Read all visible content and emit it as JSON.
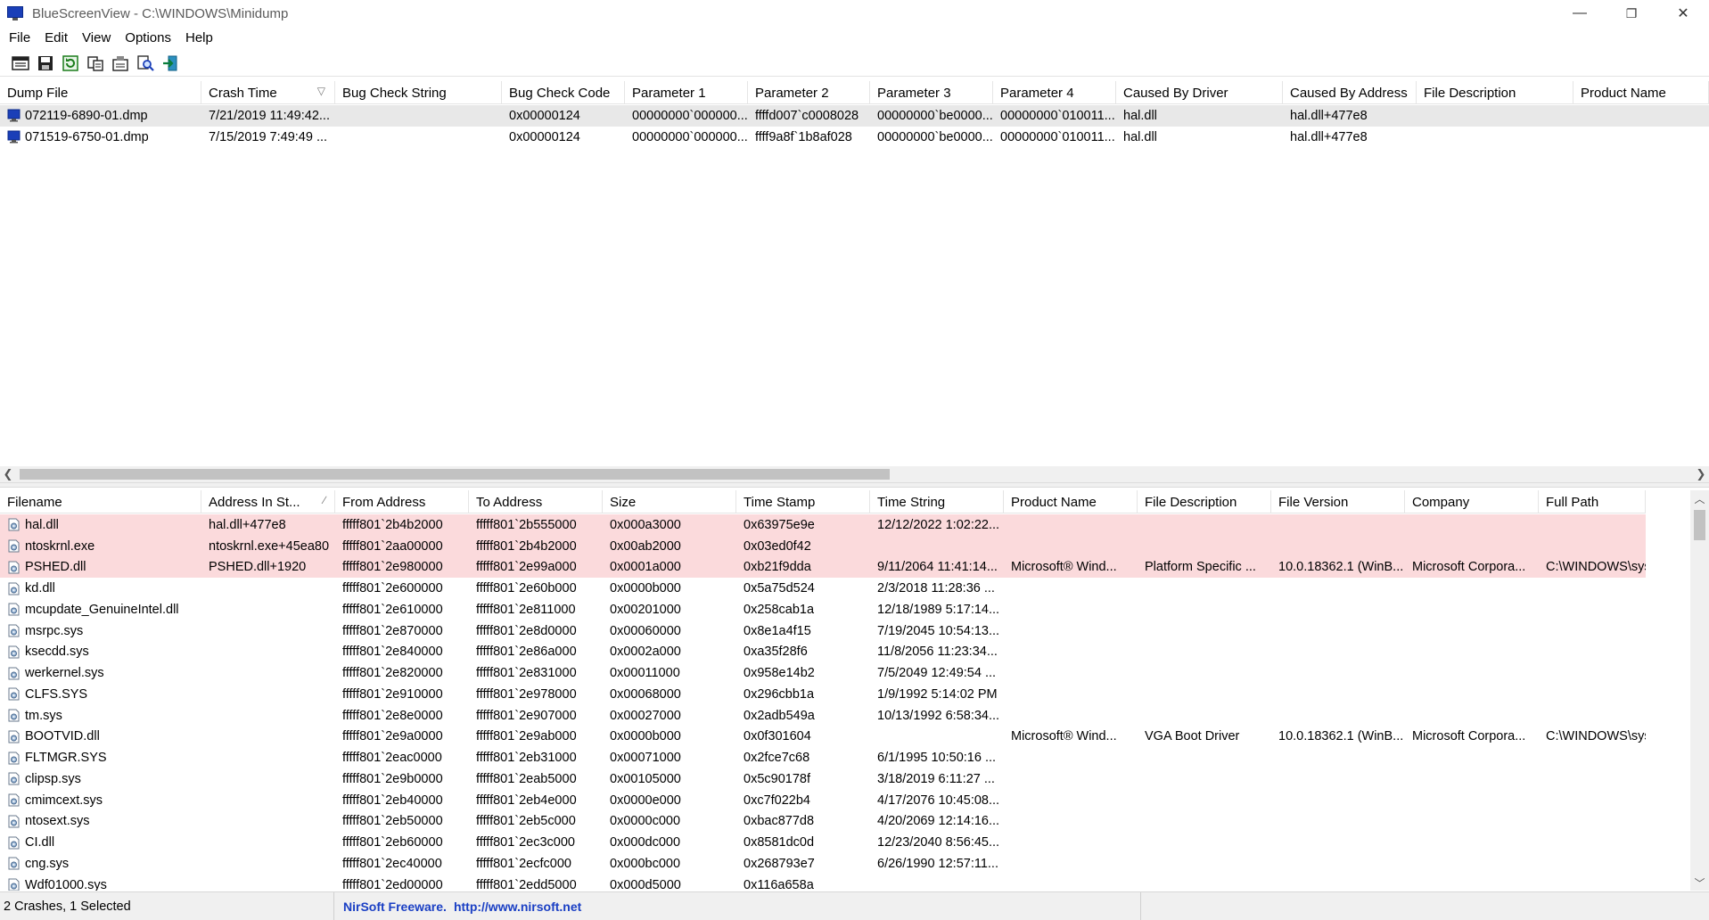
{
  "window": {
    "title": "BlueScreenView  -  C:\\WINDOWS\\Minidump",
    "minimize": "—",
    "restore": "❐",
    "close": "✕"
  },
  "menu": [
    "File",
    "Edit",
    "View",
    "Options",
    "Help"
  ],
  "toolbar": [
    {
      "name": "advanced-options-icon"
    },
    {
      "name": "save-icon"
    },
    {
      "name": "refresh-icon"
    },
    {
      "name": "copy-icon"
    },
    {
      "name": "properties-icon"
    },
    {
      "name": "find-icon"
    },
    {
      "name": "exit-icon"
    }
  ],
  "crash_list": {
    "columns": [
      {
        "label": "Dump File",
        "w": 226,
        "sort": ""
      },
      {
        "label": "Crash Time",
        "w": 150,
        "sort": "▽"
      },
      {
        "label": "Bug Check String",
        "w": 187,
        "sort": ""
      },
      {
        "label": "Bug Check Code",
        "w": 138,
        "sort": ""
      },
      {
        "label": "Parameter 1",
        "w": 138,
        "sort": ""
      },
      {
        "label": "Parameter 2",
        "w": 137,
        "sort": ""
      },
      {
        "label": "Parameter 3",
        "w": 138,
        "sort": ""
      },
      {
        "label": "Parameter 4",
        "w": 138,
        "sort": ""
      },
      {
        "label": "Caused By Driver",
        "w": 187,
        "sort": ""
      },
      {
        "label": "Caused By Address",
        "w": 150,
        "sort": ""
      },
      {
        "label": "File Description",
        "w": 176,
        "sort": ""
      },
      {
        "label": "Product Name",
        "w": 152,
        "sort": ""
      }
    ],
    "rows": [
      {
        "selected": true,
        "cells": [
          "072119-6890-01.dmp",
          "7/21/2019 11:49:42...",
          "",
          "0x00000124",
          "00000000`000000...",
          "ffffd007`c0008028",
          "00000000`be0000...",
          "00000000`010011...",
          "hal.dll",
          "hal.dll+477e8",
          "",
          ""
        ]
      },
      {
        "selected": false,
        "cells": [
          "071519-6750-01.dmp",
          "7/15/2019 7:49:49 ...",
          "",
          "0x00000124",
          "00000000`000000...",
          "ffff9a8f`1b8af028",
          "00000000`be0000...",
          "00000000`010011...",
          "hal.dll",
          "hal.dll+477e8",
          "",
          ""
        ]
      }
    ]
  },
  "driver_list": {
    "columns": [
      {
        "label": "Filename",
        "w": 226,
        "sort": ""
      },
      {
        "label": "Address In St...",
        "w": 150,
        "sort": "∕"
      },
      {
        "label": "From Address",
        "w": 150,
        "sort": ""
      },
      {
        "label": "To Address",
        "w": 150,
        "sort": ""
      },
      {
        "label": "Size",
        "w": 150,
        "sort": ""
      },
      {
        "label": "Time Stamp",
        "w": 150,
        "sort": ""
      },
      {
        "label": "Time String",
        "w": 150,
        "sort": ""
      },
      {
        "label": "Product Name",
        "w": 150,
        "sort": ""
      },
      {
        "label": "File Description",
        "w": 150,
        "sort": ""
      },
      {
        "label": "File Version",
        "w": 150,
        "sort": ""
      },
      {
        "label": "Company",
        "w": 150,
        "sort": ""
      },
      {
        "label": "Full Path",
        "w": 120,
        "sort": ""
      }
    ],
    "rows": [
      {
        "highlight": true,
        "cells": [
          "hal.dll",
          "hal.dll+477e8",
          "fffff801`2b4b2000",
          "fffff801`2b555000",
          "0x000a3000",
          "0x63975e9e",
          "12/12/2022 1:02:22...",
          "",
          "",
          "",
          "",
          ""
        ]
      },
      {
        "highlight": true,
        "cells": [
          "ntoskrnl.exe",
          "ntoskrnl.exe+45ea80",
          "fffff801`2aa00000",
          "fffff801`2b4b2000",
          "0x00ab2000",
          "0x03ed0f42",
          "",
          "",
          "",
          "",
          "",
          ""
        ]
      },
      {
        "highlight": true,
        "cells": [
          "PSHED.dll",
          "PSHED.dll+1920",
          "fffff801`2e980000",
          "fffff801`2e99a000",
          "0x0001a000",
          "0xb21f9dda",
          "9/11/2064 11:41:14...",
          "Microsoft® Wind...",
          "Platform Specific ...",
          "10.0.18362.1 (WinB...",
          "Microsoft Corpora...",
          "C:\\WINDOWS\\syst..."
        ]
      },
      {
        "highlight": false,
        "cells": [
          "kd.dll",
          "",
          "fffff801`2e600000",
          "fffff801`2e60b000",
          "0x0000b000",
          "0x5a75d524",
          "2/3/2018 11:28:36 ...",
          "",
          "",
          "",
          "",
          ""
        ]
      },
      {
        "highlight": false,
        "cells": [
          "mcupdate_GenuineIntel.dll",
          "",
          "fffff801`2e610000",
          "fffff801`2e811000",
          "0x00201000",
          "0x258cab1a",
          "12/18/1989 5:17:14...",
          "",
          "",
          "",
          "",
          ""
        ]
      },
      {
        "highlight": false,
        "cells": [
          "msrpc.sys",
          "",
          "fffff801`2e870000",
          "fffff801`2e8d0000",
          "0x00060000",
          "0x8e1a4f15",
          "7/19/2045 10:54:13...",
          "",
          "",
          "",
          "",
          ""
        ]
      },
      {
        "highlight": false,
        "cells": [
          "ksecdd.sys",
          "",
          "fffff801`2e840000",
          "fffff801`2e86a000",
          "0x0002a000",
          "0xa35f28f6",
          "11/8/2056 11:23:34...",
          "",
          "",
          "",
          "",
          ""
        ]
      },
      {
        "highlight": false,
        "cells": [
          "werkernel.sys",
          "",
          "fffff801`2e820000",
          "fffff801`2e831000",
          "0x00011000",
          "0x958e14b2",
          "7/5/2049 12:49:54 ...",
          "",
          "",
          "",
          "",
          ""
        ]
      },
      {
        "highlight": false,
        "cells": [
          "CLFS.SYS",
          "",
          "fffff801`2e910000",
          "fffff801`2e978000",
          "0x00068000",
          "0x296cbb1a",
          "1/9/1992 5:14:02 PM",
          "",
          "",
          "",
          "",
          ""
        ]
      },
      {
        "highlight": false,
        "cells": [
          "tm.sys",
          "",
          "fffff801`2e8e0000",
          "fffff801`2e907000",
          "0x00027000",
          "0x2adb549a",
          "10/13/1992 6:58:34...",
          "",
          "",
          "",
          "",
          ""
        ]
      },
      {
        "highlight": false,
        "cells": [
          "BOOTVID.dll",
          "",
          "fffff801`2e9a0000",
          "fffff801`2e9ab000",
          "0x0000b000",
          "0x0f301604",
          "",
          "Microsoft® Wind...",
          "VGA Boot Driver",
          "10.0.18362.1 (WinB...",
          "Microsoft Corpora...",
          "C:\\WINDOWS\\syst..."
        ]
      },
      {
        "highlight": false,
        "cells": [
          "FLTMGR.SYS",
          "",
          "fffff801`2eac0000",
          "fffff801`2eb31000",
          "0x00071000",
          "0x2fce7c68",
          "6/1/1995 10:50:16 ...",
          "",
          "",
          "",
          "",
          ""
        ]
      },
      {
        "highlight": false,
        "cells": [
          "clipsp.sys",
          "",
          "fffff801`2e9b0000",
          "fffff801`2eab5000",
          "0x00105000",
          "0x5c90178f",
          "3/18/2019 6:11:27 ...",
          "",
          "",
          "",
          "",
          ""
        ]
      },
      {
        "highlight": false,
        "cells": [
          "cmimcext.sys",
          "",
          "fffff801`2eb40000",
          "fffff801`2eb4e000",
          "0x0000e000",
          "0xc7f022b4",
          "4/17/2076 10:45:08...",
          "",
          "",
          "",
          "",
          ""
        ]
      },
      {
        "highlight": false,
        "cells": [
          "ntosext.sys",
          "",
          "fffff801`2eb50000",
          "fffff801`2eb5c000",
          "0x0000c000",
          "0xbac877d8",
          "4/20/2069 12:14:16...",
          "",
          "",
          "",
          "",
          ""
        ]
      },
      {
        "highlight": false,
        "cells": [
          "CI.dll",
          "",
          "fffff801`2eb60000",
          "fffff801`2ec3c000",
          "0x000dc000",
          "0x8581dc0d",
          "12/23/2040 8:56:45...",
          "",
          "",
          "",
          "",
          ""
        ]
      },
      {
        "highlight": false,
        "cells": [
          "cng.sys",
          "",
          "fffff801`2ec40000",
          "fffff801`2ecfc000",
          "0x000bc000",
          "0x268793e7",
          "6/26/1990 12:57:11...",
          "",
          "",
          "",
          "",
          ""
        ]
      },
      {
        "highlight": false,
        "cells": [
          "Wdf01000.sys",
          "",
          "fffff801`2ed00000",
          "fffff801`2edd5000",
          "0x000d5000",
          "0x116a658a",
          "",
          "",
          "",
          "",
          "",
          ""
        ]
      }
    ]
  },
  "status": {
    "summary": "2 Crashes, 1 Selected",
    "vendor": "NirSoft Freeware.",
    "url": "http://www.nirsoft.net"
  },
  "colors": {
    "highlight_row": "#fbdadc",
    "selected_row": "#e8e8e8",
    "link": "#1a3fc4"
  }
}
